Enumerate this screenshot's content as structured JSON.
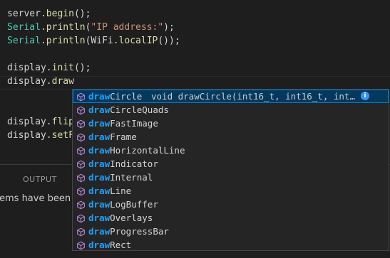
{
  "editor": {
    "lines": [
      {
        "segments": [
          {
            "t": "server",
            "c": "obj"
          },
          {
            "t": ".",
            "c": "pun"
          },
          {
            "t": "begin",
            "c": "fn"
          },
          {
            "t": "();",
            "c": "pun"
          }
        ]
      },
      {
        "segments": [
          {
            "t": "Serial",
            "c": "cls"
          },
          {
            "t": ".",
            "c": "pun"
          },
          {
            "t": "println",
            "c": "fn"
          },
          {
            "t": "(",
            "c": "pun"
          },
          {
            "t": "\"IP address:\"",
            "c": "str"
          },
          {
            "t": ");",
            "c": "pun"
          }
        ]
      },
      {
        "segments": [
          {
            "t": "Serial",
            "c": "cls"
          },
          {
            "t": ".",
            "c": "pun"
          },
          {
            "t": "println",
            "c": "fn"
          },
          {
            "t": "(",
            "c": "pun"
          },
          {
            "t": "WiFi",
            "c": "obj"
          },
          {
            "t": ".",
            "c": "pun"
          },
          {
            "t": "localIP",
            "c": "fn"
          },
          {
            "t": "());",
            "c": "pun"
          }
        ]
      },
      {
        "segments": []
      },
      {
        "segments": [
          {
            "t": "display",
            "c": "obj"
          },
          {
            "t": ".",
            "c": "pun"
          },
          {
            "t": "init",
            "c": "fn"
          },
          {
            "t": "();",
            "c": "pun"
          }
        ]
      },
      {
        "segments": [
          {
            "t": "display",
            "c": "obj"
          },
          {
            "t": ".",
            "c": "pun"
          },
          {
            "t": "draw",
            "c": "fn"
          }
        ]
      },
      {
        "segments": []
      },
      {
        "segments": []
      },
      {
        "segments": [
          {
            "t": "display",
            "c": "obj"
          },
          {
            "t": ".",
            "c": "pun"
          },
          {
            "t": "flip",
            "c": "fn"
          }
        ]
      },
      {
        "segments": [
          {
            "t": "display",
            "c": "obj"
          },
          {
            "t": ".",
            "c": "pun"
          },
          {
            "t": "setF",
            "c": "fn"
          }
        ]
      }
    ]
  },
  "panel": {
    "tab_label": "OUTPUT",
    "text": "ems have been de"
  },
  "suggest": {
    "typed_prefix": "draw",
    "selected_detail": "void drawCircle(int16_t, int16_t, int…",
    "items": [
      {
        "match": "draw",
        "rest": "Circle",
        "icon": "method-icon"
      },
      {
        "match": "draw",
        "rest": "CircleQuads",
        "icon": "method-icon"
      },
      {
        "match": "draw",
        "rest": "FastImage",
        "icon": "method-icon"
      },
      {
        "match": "draw",
        "rest": "Frame",
        "icon": "method-icon"
      },
      {
        "match": "draw",
        "rest": "HorizontalLine",
        "icon": "method-icon"
      },
      {
        "match": "draw",
        "rest": "Indicator",
        "icon": "method-icon"
      },
      {
        "match": "draw",
        "rest": "Internal",
        "icon": "method-icon"
      },
      {
        "match": "draw",
        "rest": "Line",
        "icon": "method-icon"
      },
      {
        "match": "draw",
        "rest": "LogBuffer",
        "icon": "method-icon"
      },
      {
        "match": "draw",
        "rest": "Overlays",
        "icon": "method-icon"
      },
      {
        "match": "draw",
        "rest": "ProgressBar",
        "icon": "method-icon"
      },
      {
        "match": "draw",
        "rest": "Rect",
        "icon": "method-icon"
      }
    ],
    "selected_index": 0,
    "info_glyph": "i"
  },
  "colors": {
    "background": "#1e1e1e",
    "suggest_background": "#252526",
    "selected_row": "#04395e",
    "selected_outline": "#007fd4",
    "match_highlight": "#18a3ff",
    "method_icon": "#b180d7",
    "class_token": "#4ec9b0",
    "function_token": "#dcdcaa",
    "string_token": "#ce9178"
  }
}
